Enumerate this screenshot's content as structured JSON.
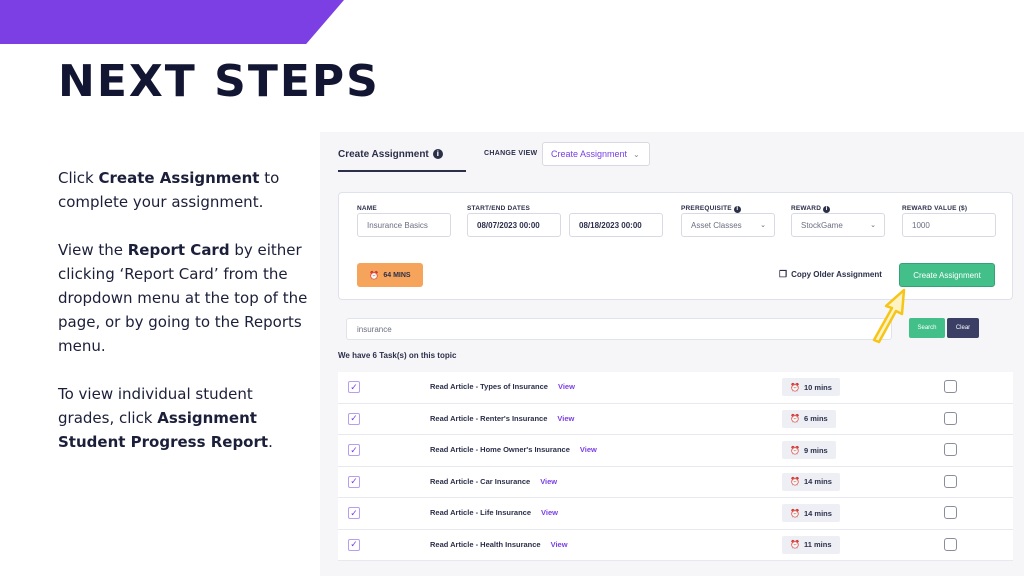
{
  "slide": {
    "title": "NEXT STEPS",
    "para1": {
      "before": "Click ",
      "bold": "Create Assignment",
      "after": " to complete your assignment."
    },
    "para2": {
      "before": "View the ",
      "bold": "Report Card",
      "after": " by either clicking ‘Report Card’ from the dropdown menu at the top of the page, or by going to the Reports menu."
    },
    "para3": {
      "before": "To view individual student grades, click ",
      "bold": "Assignment Student Progress Report",
      "after": "."
    },
    "accent_color": "#7b3fe4"
  },
  "app": {
    "tab_active": "Create Assignment",
    "change_view_label": "CHANGE VIEW",
    "change_view_value": "Create Assignment",
    "form": {
      "name_label": "NAME",
      "name_value": "Insurance Basics",
      "dates_label": "START/END DATES",
      "start_date": "08/07/2023 00:00",
      "end_date": "08/18/2023 00:00",
      "prereq_label": "PREREQUISITE",
      "prereq_value": "Asset Classes",
      "reward_label": "REWARD",
      "reward_value": "StockGame",
      "reward_amount_label": "REWARD VALUE ($)",
      "reward_amount_value": "1000",
      "mins_badge": "64 MINS",
      "copy_older": "Copy Older Assignment",
      "create_button": "Create Assignment"
    },
    "search": {
      "value": "insurance",
      "search_button": "Search",
      "clear_button": "Clear"
    },
    "task_count_text": "We have 6 Task(s) on this topic",
    "view_label": "View",
    "tasks": [
      {
        "title": "Read Article - Types of Insurance",
        "time": "10 mins"
      },
      {
        "title": "Read Article - Renter's Insurance",
        "time": "6 mins"
      },
      {
        "title": "Read Article - Home Owner's Insurance",
        "time": "9 mins"
      },
      {
        "title": "Read Article - Car Insurance",
        "time": "14 mins"
      },
      {
        "title": "Read Article - Life Insurance",
        "time": "14 mins"
      },
      {
        "title": "Read Article - Health Insurance",
        "time": "11 mins"
      }
    ],
    "colors": {
      "green": "#43c08a",
      "navy": "#3b3f66",
      "orange": "#f6a45b",
      "arrow": "#f5c518"
    }
  }
}
